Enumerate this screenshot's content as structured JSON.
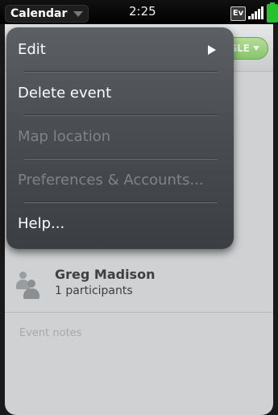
{
  "status_bar": {
    "app_name": "Calendar",
    "time": "2:25",
    "network_badge": "Ev",
    "icons": [
      "chevron-down-icon",
      "signal-icon",
      "battery-icon"
    ]
  },
  "background": {
    "account_pill": "GLE",
    "participant": {
      "name": "Greg Madison",
      "count_label": "1 participants"
    },
    "notes_placeholder": "Event notes"
  },
  "menu": {
    "items": [
      {
        "label": "Edit",
        "enabled": true,
        "has_submenu": true
      },
      {
        "label": "Delete event",
        "enabled": true,
        "has_submenu": false
      },
      {
        "label": "Map location",
        "enabled": false,
        "has_submenu": false
      },
      {
        "label": "Preferences & Accounts...",
        "enabled": false,
        "has_submenu": false
      },
      {
        "label": "Help...",
        "enabled": true,
        "has_submenu": false
      }
    ]
  },
  "colors": {
    "accent_green": "#87c56c",
    "menu_bg": "#4a4e52",
    "disabled_text": "#7f8386"
  }
}
